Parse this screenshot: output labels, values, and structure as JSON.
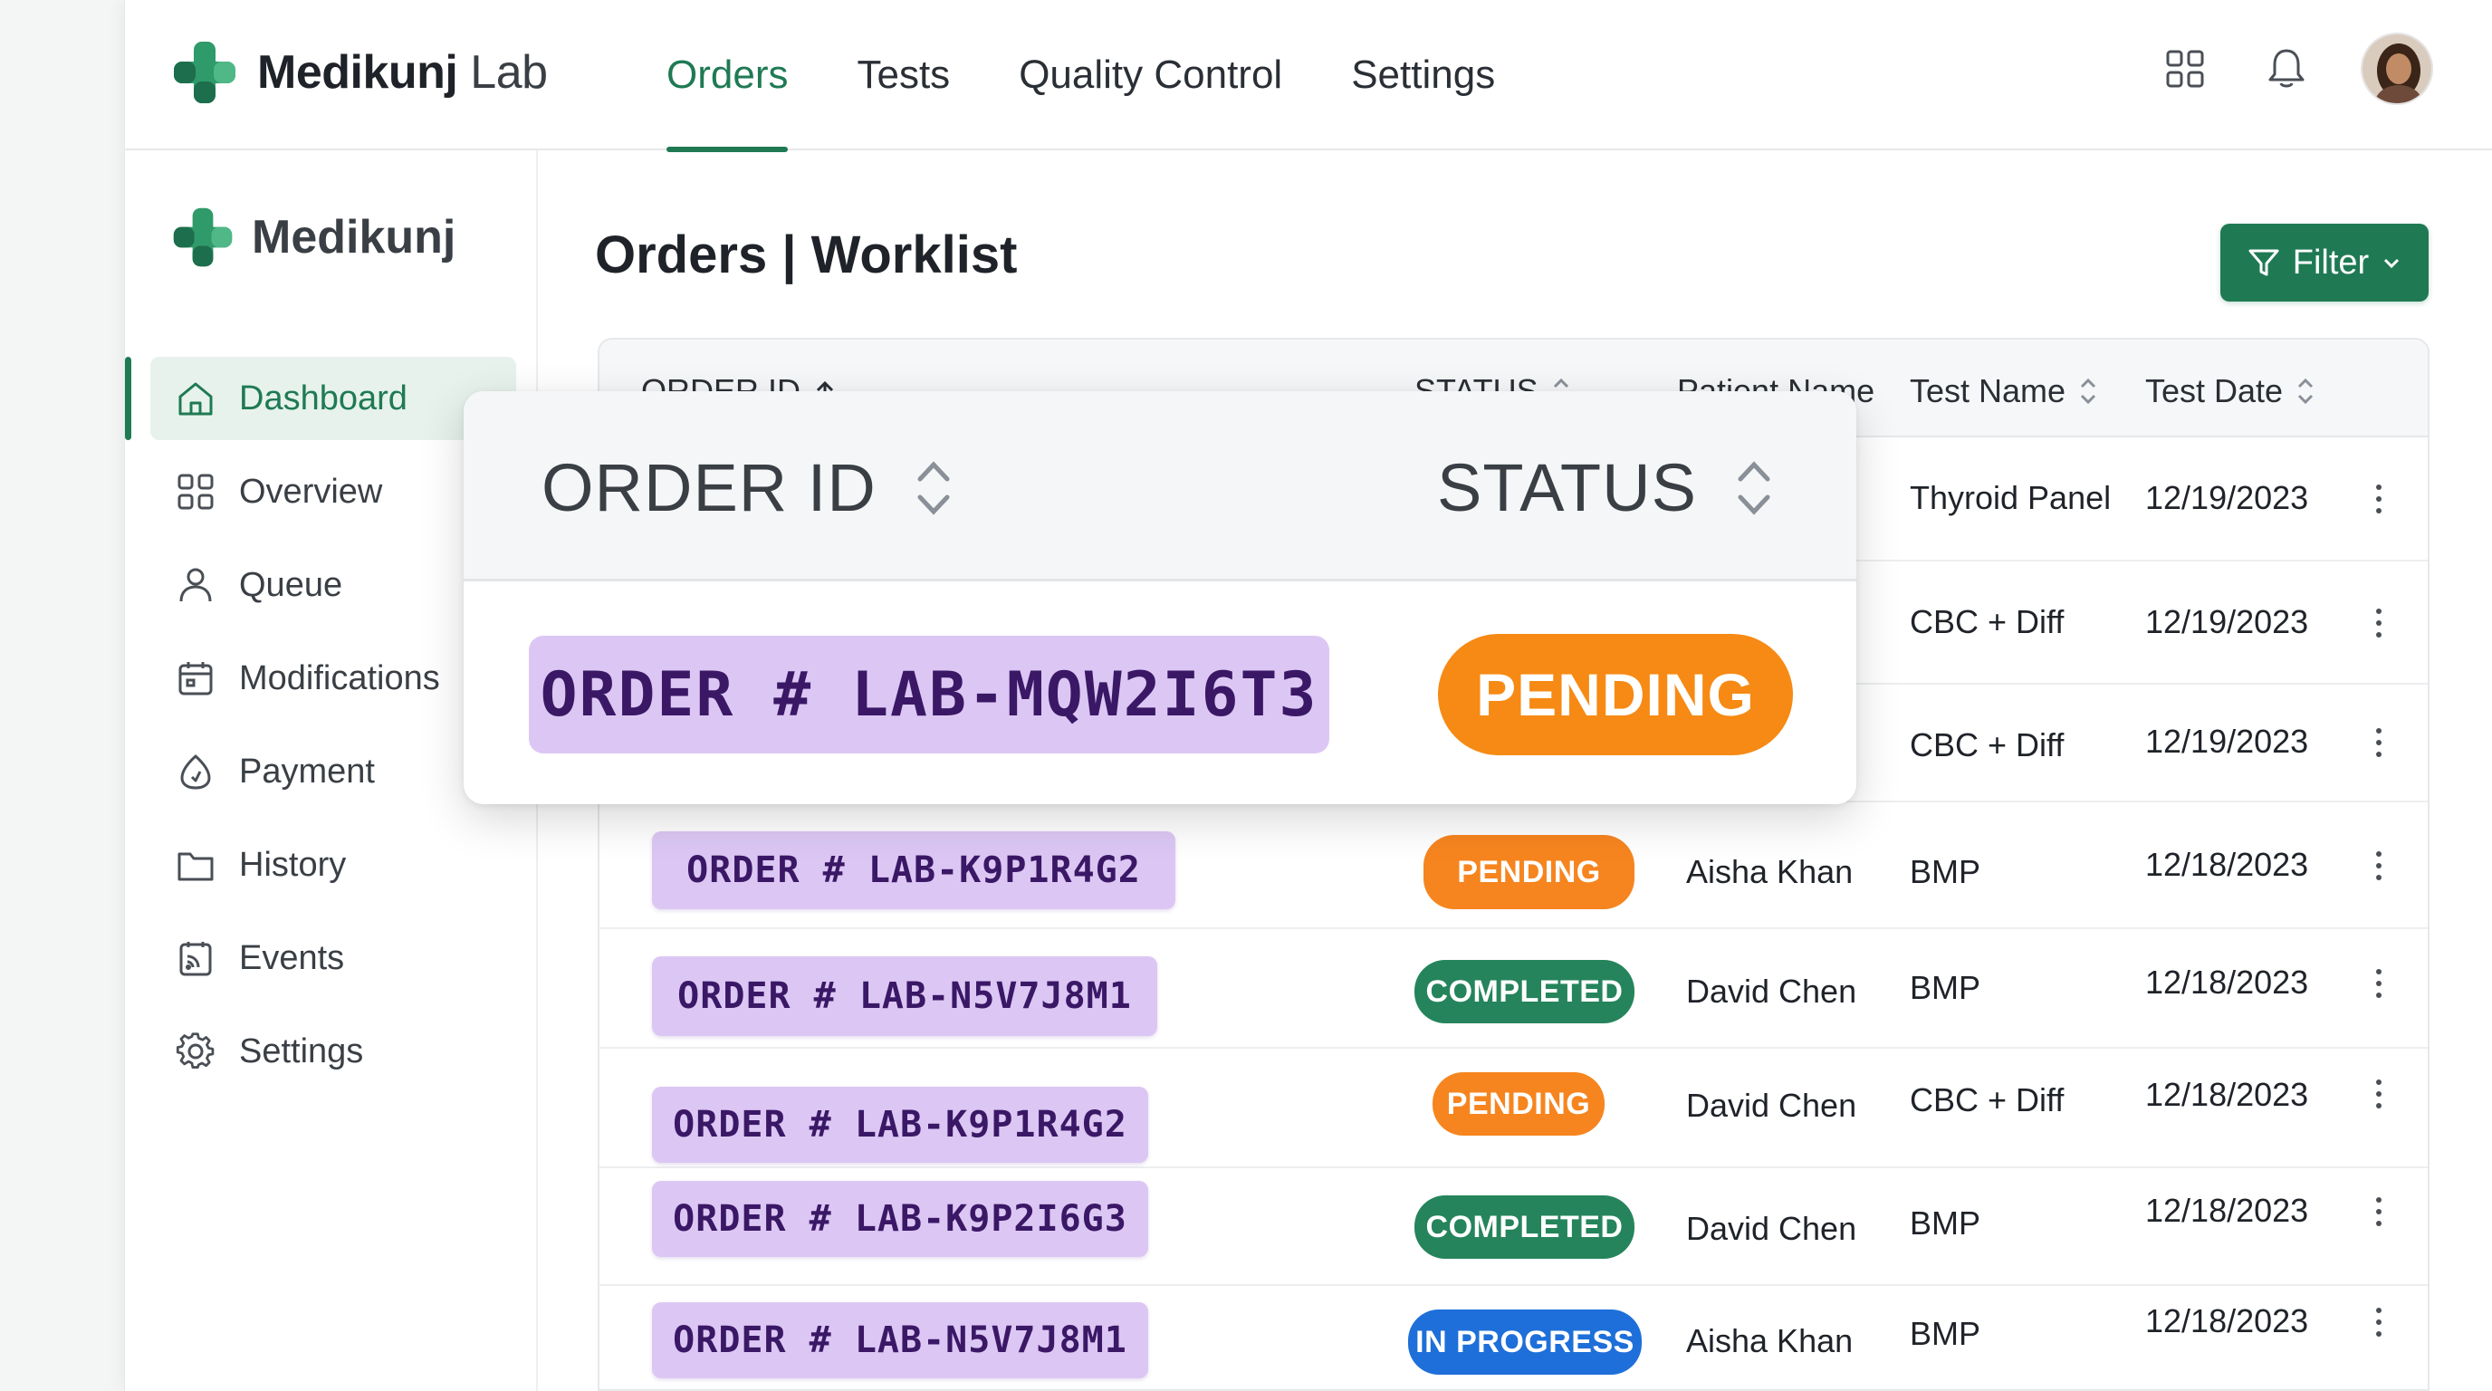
{
  "header": {
    "brand_bold": "Medikunj",
    "brand_light": "Lab",
    "nav": [
      {
        "label": "Orders"
      },
      {
        "label": "Tests"
      },
      {
        "label": "Quality Control"
      },
      {
        "label": "Settings"
      }
    ],
    "icons": [
      "grid-icon",
      "bell-icon",
      "user-avatar"
    ]
  },
  "sidebar": {
    "brand": "Medikunj",
    "items": [
      {
        "label": "Dashboard",
        "icon": "home-icon"
      },
      {
        "label": "Overview",
        "icon": "grid-icon"
      },
      {
        "label": "Queue",
        "icon": "person-icon"
      },
      {
        "label": "Modifications",
        "icon": "calendar-icon"
      },
      {
        "label": "Payment",
        "icon": "payment-icon"
      },
      {
        "label": "History",
        "icon": "folder-icon"
      },
      {
        "label": "Events",
        "icon": "events-icon"
      },
      {
        "label": "Settings",
        "icon": "gear-icon"
      }
    ]
  },
  "main": {
    "title": "Orders | Worklist",
    "filter_label": "Filter"
  },
  "table": {
    "columns": [
      "ORDER ID",
      "STATUS",
      "Patient Name",
      "Test Name",
      "Test Date"
    ],
    "rows": [
      {
        "test": "Thyroid Panel",
        "date": "12/19/2023"
      },
      {
        "test": "CBC + Diff",
        "date": "12/19/2023"
      },
      {
        "test": "CBC + Diff",
        "date": "12/19/2023"
      },
      {
        "order": "ORDER # LAB-K9P1R4G2",
        "status": "PENDING",
        "patient": "Aisha Khan",
        "test": "BMP",
        "date": "12/18/2023"
      },
      {
        "order": "ORDER # LAB-N5V7J8M1",
        "status": "COMPLETED",
        "patient": "David Chen",
        "test": "BMP",
        "date": "12/18/2023"
      },
      {
        "order": "ORDER # LAB-K9P1R4G2",
        "status": "PENDING",
        "patient": "David Chen",
        "test": "CBC + Diff",
        "date": "12/18/2023"
      },
      {
        "order": "ORDER # LAB-K9P2I6G3",
        "status": "COMPLETED",
        "patient": "David Chen",
        "test": "BMP",
        "date": "12/18/2023"
      },
      {
        "order": "ORDER # LAB-N5V7J8M1",
        "status": "IN PROGRESS",
        "patient": "Aisha Khan",
        "test": "BMP",
        "date": "12/18/2023"
      }
    ]
  },
  "zoom": {
    "col_order": "ORDER ID",
    "col_status": "STATUS",
    "order": "ORDER # LAB-MQW2I6T3",
    "status": "PENDING"
  },
  "colors": {
    "brand_green": "#1f7a54",
    "chip_purple": "#dcc7f4",
    "pending": "#f6851f",
    "completed": "#25845b",
    "in_progress": "#1e6fd9"
  }
}
